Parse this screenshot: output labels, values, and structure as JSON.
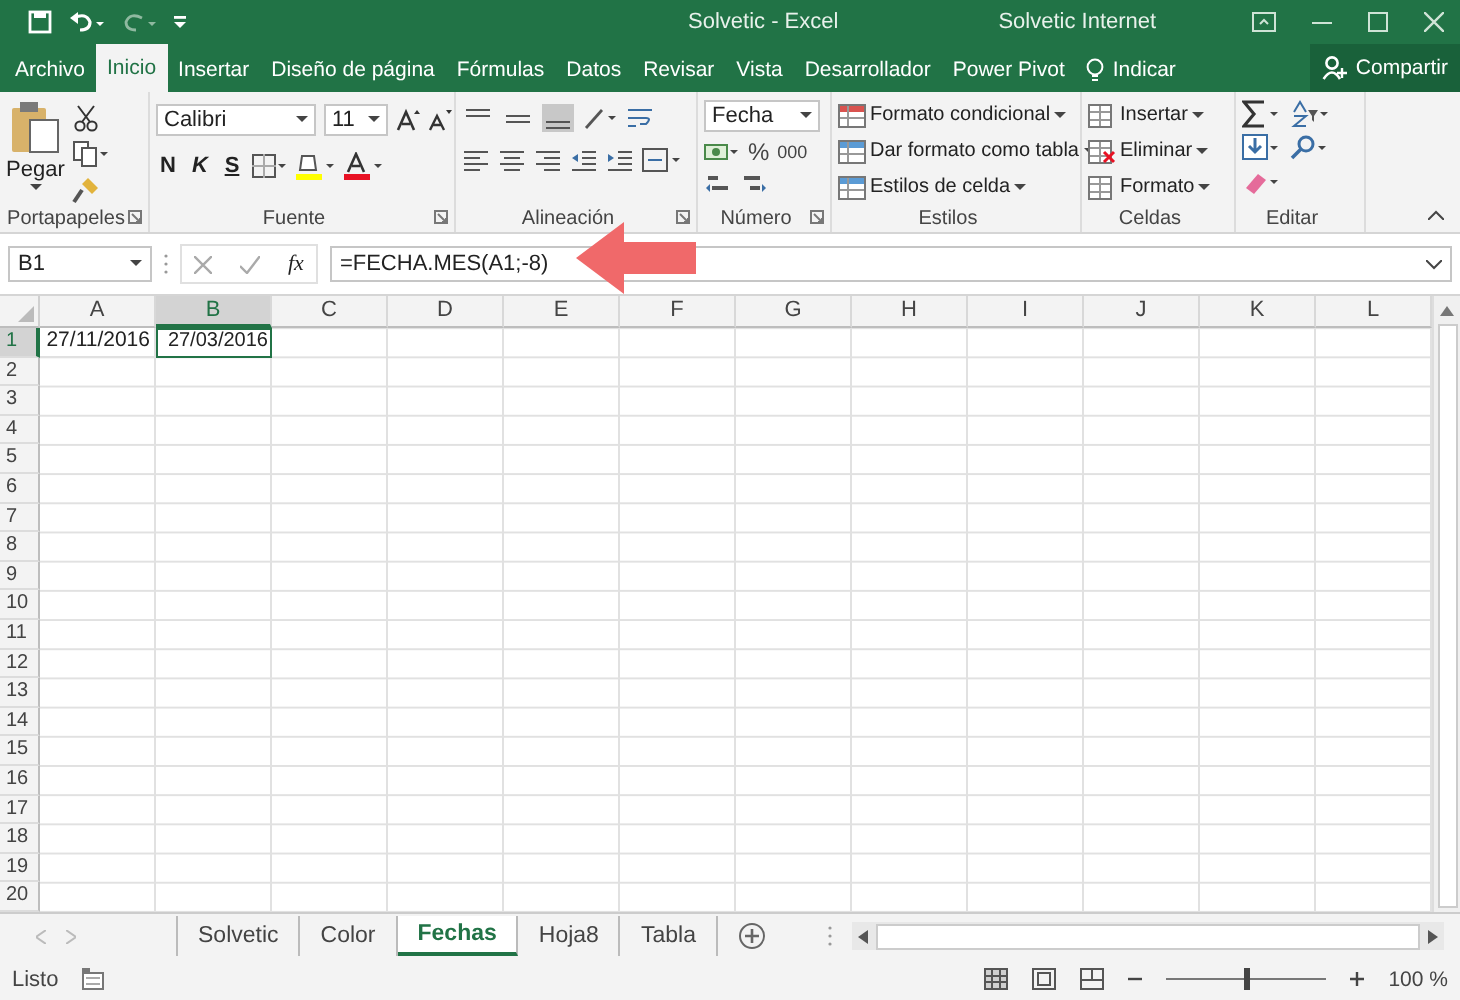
{
  "window": {
    "title": "Solvetic - Excel",
    "account": "Solvetic Internet"
  },
  "ribbon_tabs": [
    {
      "label": "Archivo",
      "selected": false
    },
    {
      "label": "Inicio",
      "selected": true
    },
    {
      "label": "Insertar",
      "selected": false
    },
    {
      "label": "Diseño de página",
      "selected": false
    },
    {
      "label": "Fórmulas",
      "selected": false
    },
    {
      "label": "Datos",
      "selected": false
    },
    {
      "label": "Revisar",
      "selected": false
    },
    {
      "label": "Vista",
      "selected": false
    },
    {
      "label": "Desarrollador",
      "selected": false
    },
    {
      "label": "Power Pivot",
      "selected": false
    }
  ],
  "tell_me": "Indicar",
  "share": "Compartir",
  "ribbon_groups": [
    {
      "kind": "clipboard",
      "label": "Portapapeles",
      "items": [
        "Pegar"
      ]
    },
    {
      "kind": "font",
      "label": "Fuente",
      "items": [
        "Calibri",
        "11",
        "N",
        "K",
        "S"
      ]
    },
    {
      "kind": "alignment",
      "label": "Alineación"
    },
    {
      "kind": "number",
      "label": "Número",
      "items": [
        "Fecha",
        "%",
        "000"
      ]
    },
    {
      "kind": "styles",
      "label": "Estilos",
      "items": [
        "Formato condicional",
        "Dar formato como tabla",
        "Estilos de celda"
      ]
    },
    {
      "kind": "cells",
      "label": "Celdas",
      "items": [
        "Insertar",
        "Eliminar",
        "Formato"
      ]
    },
    {
      "kind": "editing",
      "label": "Editar"
    }
  ],
  "formula_bar": {
    "name_box": "B1",
    "fx": "fx",
    "formula": "=FECHA.MES(A1;-8)"
  },
  "columns": [
    {
      "label": "A",
      "selected": false
    },
    {
      "label": "B",
      "selected": true
    },
    {
      "label": "C",
      "selected": false
    },
    {
      "label": "D",
      "selected": false
    },
    {
      "label": "E",
      "selected": false
    },
    {
      "label": "F",
      "selected": false
    },
    {
      "label": "G",
      "selected": false
    },
    {
      "label": "H",
      "selected": false
    },
    {
      "label": "I",
      "selected": false
    },
    {
      "label": "J",
      "selected": false
    },
    {
      "label": "K",
      "selected": false
    },
    {
      "label": "L",
      "selected": false
    }
  ],
  "rows": [
    {
      "number": "1",
      "selected": true,
      "cells": [
        {
          "text": "27/11/2016",
          "selected": false
        },
        {
          "text": "27/03/2016",
          "selected": true
        }
      ]
    },
    {
      "number": "2",
      "selected": false
    },
    {
      "number": "3",
      "selected": false
    },
    {
      "number": "4",
      "selected": false
    },
    {
      "number": "5",
      "selected": false
    },
    {
      "number": "6",
      "selected": false
    },
    {
      "number": "7",
      "selected": false
    },
    {
      "number": "8",
      "selected": false
    },
    {
      "number": "9",
      "selected": false
    },
    {
      "number": "10",
      "selected": false
    },
    {
      "number": "11",
      "selected": false
    },
    {
      "number": "12",
      "selected": false
    },
    {
      "number": "13",
      "selected": false
    },
    {
      "number": "14",
      "selected": false
    },
    {
      "number": "15",
      "selected": false
    },
    {
      "number": "16",
      "selected": false
    },
    {
      "number": "17",
      "selected": false
    },
    {
      "number": "18",
      "selected": false
    },
    {
      "number": "19",
      "selected": false
    },
    {
      "number": "20",
      "selected": false
    }
  ],
  "sheets": [
    {
      "label": "Solvetic",
      "selected": false
    },
    {
      "label": "Color",
      "selected": false
    },
    {
      "label": "Fechas",
      "selected": true
    },
    {
      "label": "Hoja8",
      "selected": false
    },
    {
      "label": "Tabla",
      "selected": false
    }
  ],
  "status_bar": {
    "text": "Listo",
    "zoom": "100 %",
    "zoom_level": {
      "level": 0.5
    }
  }
}
